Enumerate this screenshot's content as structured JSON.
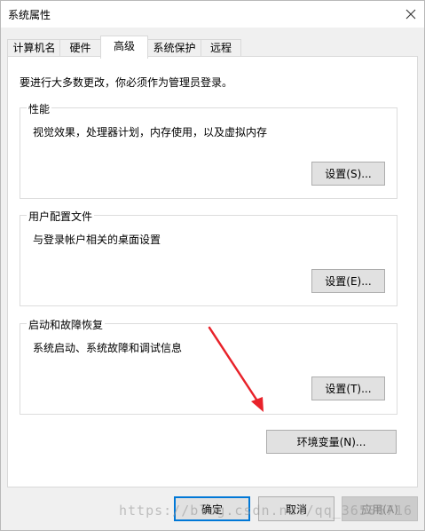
{
  "window": {
    "title": "系统属性"
  },
  "tabs": [
    {
      "label": "计算机名"
    },
    {
      "label": "硬件"
    },
    {
      "label": "高级"
    },
    {
      "label": "系统保护"
    },
    {
      "label": "远程"
    }
  ],
  "intro": "要进行大多数更改，你必须作为管理员登录。",
  "performance": {
    "label": "性能",
    "desc": "视觉效果，处理器计划，内存使用，以及虚拟内存",
    "button": "设置(S)..."
  },
  "user_profiles": {
    "label": "用户配置文件",
    "desc": "与登录帐户相关的桌面设置",
    "button": "设置(E)..."
  },
  "startup_recovery": {
    "label": "启动和故障恢复",
    "desc": "系统启动、系统故障和调试信息",
    "button": "设置(T)..."
  },
  "env_button": "环境变量(N)...",
  "footer": {
    "ok": "确定",
    "cancel": "取消",
    "apply": "应用(A)"
  },
  "watermark": "https://blog.csdn.net/qq_36586716",
  "colors": {
    "accent": "#0078d7",
    "arrow": "#e8222a"
  }
}
